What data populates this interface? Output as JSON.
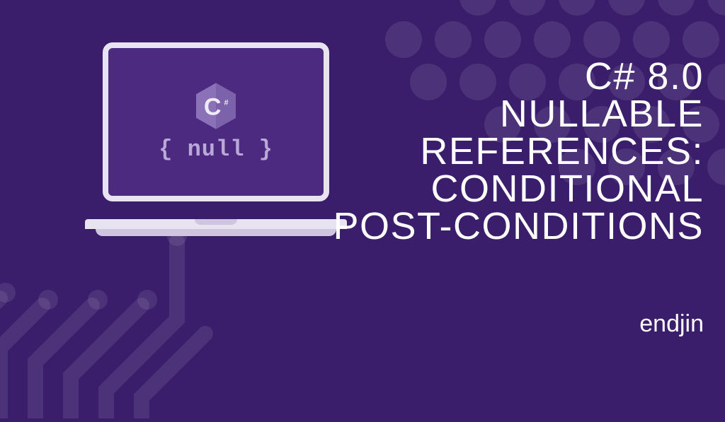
{
  "laptop": {
    "logo_letter": "C",
    "logo_hash": "#",
    "code_text": "{ null }"
  },
  "title": {
    "line1": "C# 8.0",
    "line2": "NULLABLE",
    "line3": "REFERENCES:",
    "line4": "CONDITIONAL",
    "line5": "POST-CONDITIONS"
  },
  "brand": "endjin",
  "colors": {
    "background": "#3b1e6b",
    "accent": "#b9a8d8",
    "laptop_frame": "#e8e3f0"
  }
}
